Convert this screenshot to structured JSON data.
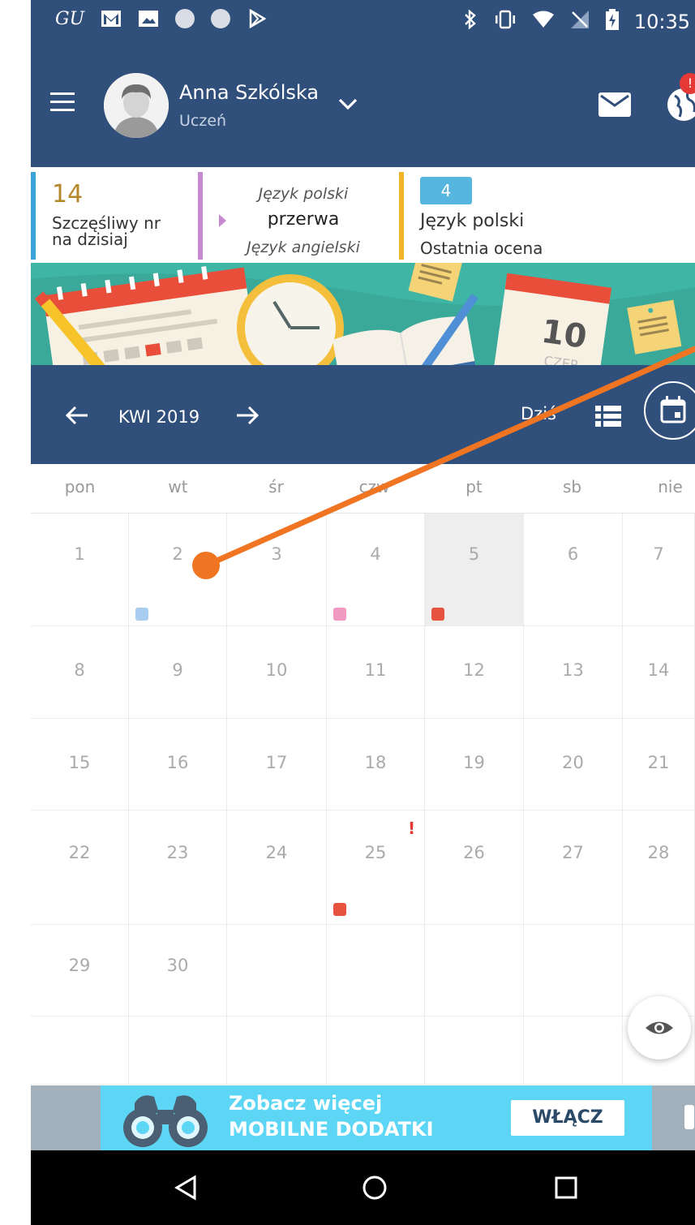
{
  "status_bar": {
    "time": "10:35",
    "left_text": "GU"
  },
  "header": {
    "user_name": "Anna Szkólska",
    "user_role": "Uczeń",
    "notification_badge": "!"
  },
  "info": {
    "lucky_number": "14",
    "lucky_label_line1": "Szczęśliwy nr",
    "lucky_label_line2": "na dzisiaj",
    "current_prev": "Język polski",
    "current_now": "przerwa",
    "current_next": "Język angielski",
    "grade_value": "4",
    "grade_subject": "Język polski",
    "grade_label": "Ostatnia ocena"
  },
  "banner": {
    "calendar_number": "10",
    "calendar_month": "CZER"
  },
  "calendar_nav": {
    "month": "KWI 2019",
    "today": "Dziś"
  },
  "weekdays": [
    "pon",
    "wt",
    "śr",
    "czw",
    "pt",
    "sb",
    "nie"
  ],
  "weeks": [
    [
      "1",
      "2",
      "3",
      "4",
      "5",
      "6",
      "7"
    ],
    [
      "8",
      "9",
      "10",
      "11",
      "12",
      "13",
      "14"
    ],
    [
      "15",
      "16",
      "17",
      "18",
      "19",
      "20",
      "21"
    ],
    [
      "22",
      "23",
      "24",
      "25",
      "26",
      "27",
      "28"
    ],
    [
      "29",
      "30",
      "",
      "",
      "",
      "",
      ""
    ],
    [
      "",
      "",
      "",
      "",
      "",
      "",
      ""
    ]
  ],
  "events": [
    {
      "day": "2",
      "color": "#a9cdf0"
    },
    {
      "day": "4",
      "color": "#f199c3"
    },
    {
      "day": "5",
      "color": "#e8533f"
    },
    {
      "day": "25",
      "color": "#e8533f"
    }
  ],
  "alert_day": {
    "day": "25",
    "mark": "!"
  },
  "highlighted_day": "5",
  "ad": {
    "line1": "Zobacz więcej",
    "line2": "MOBILNE DODATKI",
    "button": "WŁĄCZ"
  },
  "colors": {
    "primary": "#304f7a",
    "accent_orange": "#f07522"
  }
}
